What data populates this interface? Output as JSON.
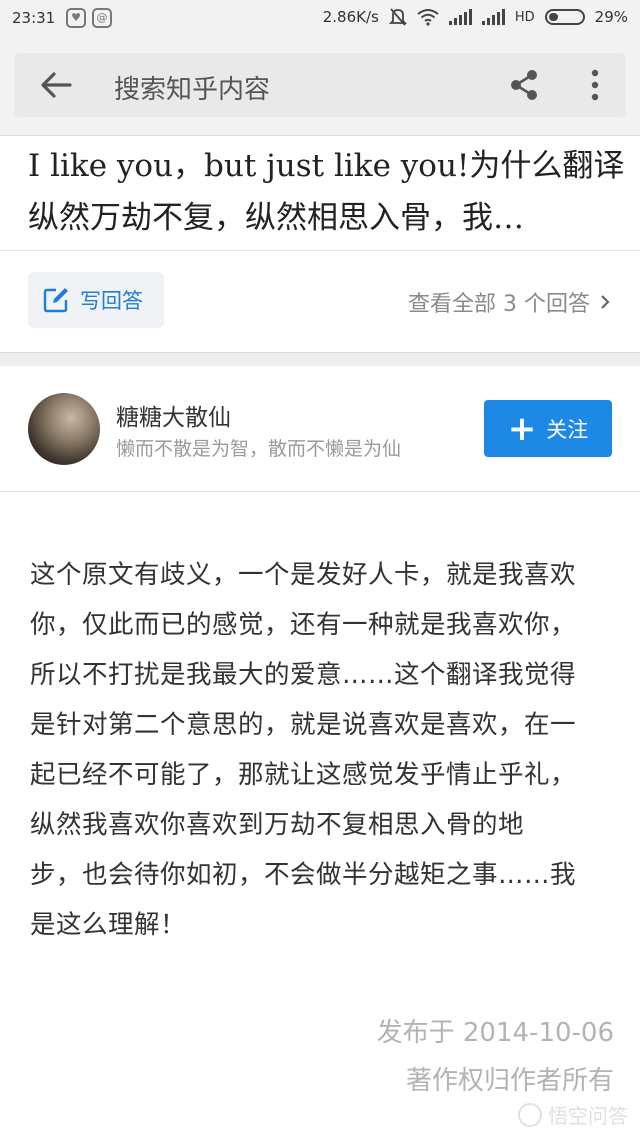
{
  "status_bar": {
    "time": "23:31",
    "net_speed": "2.86K/s",
    "network_type": "HD",
    "battery": "29%",
    "battery_level": 0.29
  },
  "header": {
    "search_placeholder": "搜索知乎内容"
  },
  "question": {
    "line1": "I like you，but just like you!为什么翻译",
    "line2": "纵然万劫不复，纵然相思入骨，我…"
  },
  "actions": {
    "write_answer": "写回答",
    "view_all": "查看全部 3 个回答"
  },
  "author": {
    "name": "糖糖大散仙",
    "bio": "懒而不散是为智，散而不懒是为仙",
    "follow": "关注"
  },
  "answer": {
    "lines": [
      "这个原文有歧义，一个是发好人卡，就是我喜欢",
      "你，仅此而已的感觉，还有一种就是我喜欢你，",
      "所以不打扰是我最大的爱意……这个翻译我觉得",
      "是针对第二个意思的，就是说喜欢是喜欢，在一",
      "起已经不可能了，那就让这感觉发乎情止乎礼，",
      "纵然我喜欢你喜欢到万劫不复相思入骨的地",
      "步，也会待你如初，不会做半分越矩之事……我",
      "是这么理解！"
    ]
  },
  "meta": {
    "published": "发布于 2014-10-06",
    "copyright": "著作权归作者所有"
  },
  "watermark": "悟空问答",
  "colors": {
    "accent": "#1e88e5",
    "link": "#1e7fd4",
    "muted": "#9a9a9a"
  }
}
